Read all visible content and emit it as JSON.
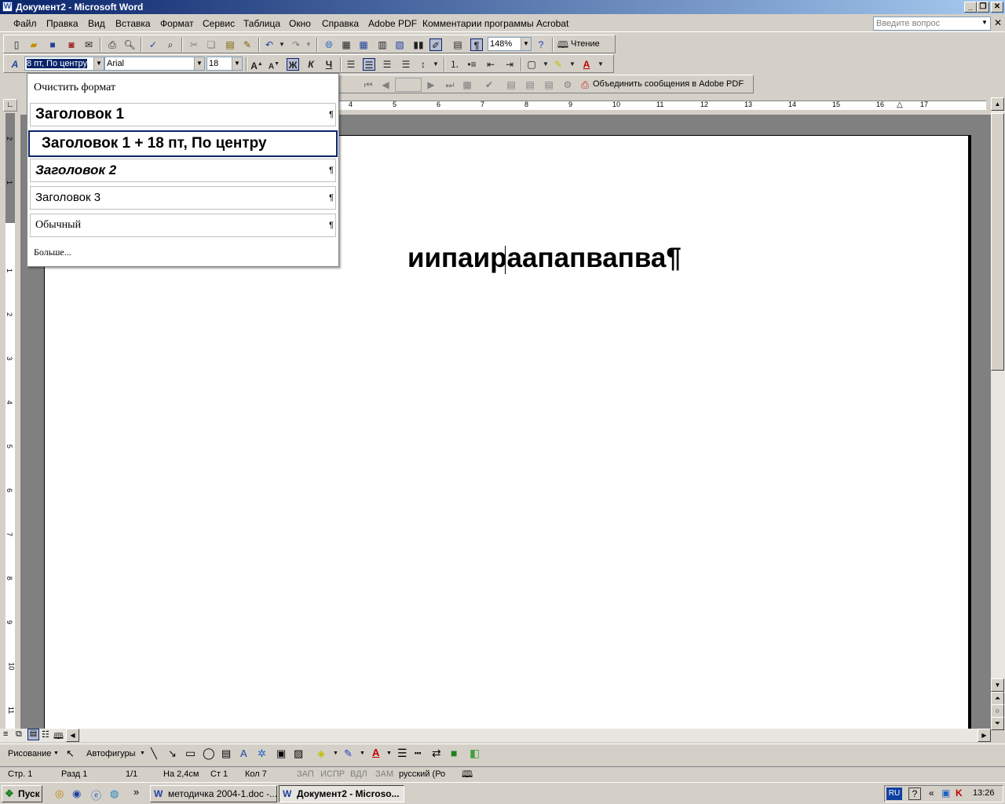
{
  "window": {
    "title": "Документ2 - Microsoft Word"
  },
  "menu": {
    "items": [
      "Файл",
      "Правка",
      "Вид",
      "Вставка",
      "Формат",
      "Сервис",
      "Таблица",
      "Окно",
      "Справка",
      "Adobe PDF",
      "Комментарии программы Acrobat"
    ],
    "help_placeholder": "Введите вопрос"
  },
  "standard_toolbar": {
    "zoom": "148%",
    "reading_label": "Чтение"
  },
  "formatting_toolbar": {
    "style_value": "8 пт, По центру",
    "font": "Arial",
    "size": "18",
    "bold_label": "Ж",
    "italic_label": "К",
    "underline_label": "Ч"
  },
  "acrobat_toolbar": {
    "merge_label": "Объединить сообщения в Adobe PDF"
  },
  "styles_dropdown": {
    "clear": "Очистить формат",
    "items": [
      "Заголовок 1",
      "Заголовок 1 + 18 пт, По центру",
      "Заголовок 2",
      "Заголовок 3",
      "Обычный"
    ],
    "more": "Больше...",
    "pilcrow": "¶"
  },
  "ruler": {
    "h_labels": [
      "4",
      "5",
      "6",
      "7",
      "8",
      "9",
      "10",
      "11",
      "12",
      "13",
      "14",
      "15",
      "16",
      "17"
    ],
    "v_labels": [
      "2",
      "1",
      "1",
      "2",
      "3",
      "4",
      "5",
      "6",
      "7",
      "8",
      "9",
      "10",
      "11"
    ]
  },
  "document": {
    "text": "иипаираапапвапва¶"
  },
  "drawing_toolbar": {
    "drawing_label": "Рисование",
    "autoshapes_label": "Автофигуры"
  },
  "status_bar": {
    "page": "Стр. 1",
    "section": "Разд 1",
    "pages": "1/1",
    "at": "На 2,4см",
    "line": "Ст 1",
    "col": "Кол 7",
    "rec": "ЗАП",
    "trk": "ИСПР",
    "ext": "ВДЛ",
    "ovr": "ЗАМ",
    "language": "русский (Ро"
  },
  "taskbar": {
    "start_label": "Пуск",
    "tasks": [
      "методичка 2004-1.doc -...",
      "Документ2 - Microso..."
    ],
    "lang": "RU",
    "time": "13:26"
  }
}
